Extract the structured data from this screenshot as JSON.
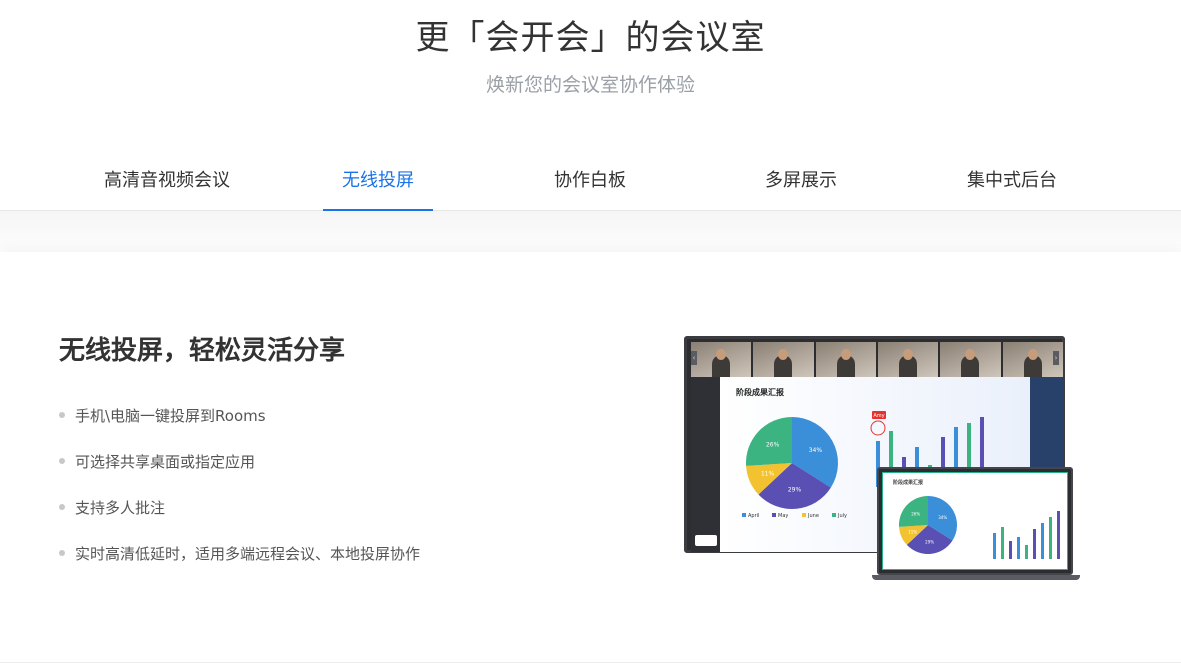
{
  "header": {
    "title": "更「会开会」的会议室",
    "subtitle": "焕新您的会议室协作体验"
  },
  "tabs": [
    {
      "label": "高清音视频会议",
      "active": false
    },
    {
      "label": "无线投屏",
      "active": true
    },
    {
      "label": "协作白板",
      "active": false
    },
    {
      "label": "多屏展示",
      "active": false
    },
    {
      "label": "集中式后台",
      "active": false
    }
  ],
  "feature": {
    "title": "无线投屏，轻松灵活分享",
    "points": [
      "手机\\电脑一键投屏到Rooms",
      "可选择共享桌面或指定应用",
      "支持多人批注",
      "实时高清低延时，适用多端远程会议、本地投屏协作"
    ]
  },
  "illustration": {
    "slide_title": "阶段成果汇报",
    "legend": [
      "April",
      "May",
      "June",
      "July"
    ],
    "pie_labels": [
      "34%",
      "29%",
      "11%",
      "26%"
    ],
    "pie_values": [
      34,
      29,
      11,
      26
    ],
    "annotation_badge": "Amy",
    "colors": {
      "pie_blue": "#3b8fd9",
      "pie_purple": "#5a4fb3",
      "pie_yellow": "#f2c230",
      "pie_green": "#3bb482",
      "accent": "#1a73e8",
      "badge_red": "#e5322d"
    }
  }
}
